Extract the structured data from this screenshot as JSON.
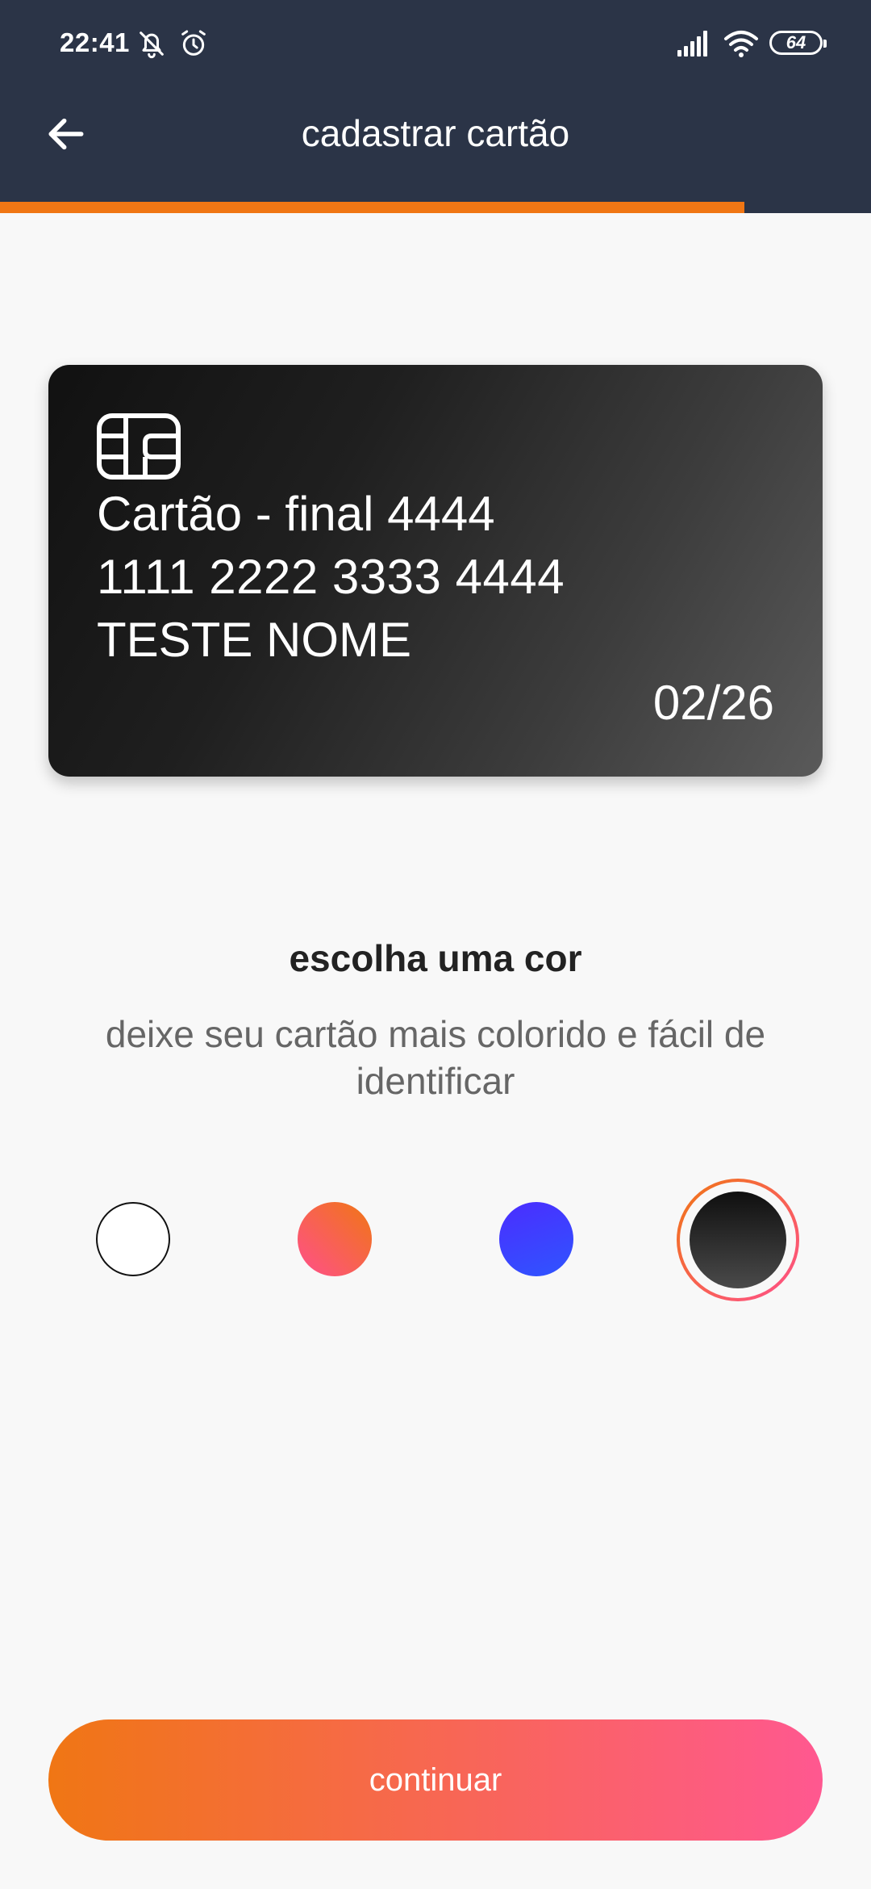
{
  "status_bar": {
    "time": "22:41",
    "battery_level": "64",
    "icons": [
      "bell-off-icon",
      "alarm-icon",
      "signal-icon",
      "wifi-icon",
      "battery-icon"
    ]
  },
  "header": {
    "title": "cadastrar cartão",
    "back_icon": "arrow-left-icon",
    "progress_fraction": 0.855,
    "background_color": "#2b3447",
    "progress_color": "#f07614"
  },
  "card": {
    "name": "Cartão - final 4444",
    "number": "1111 2222 3333 4444",
    "holder": "TESTE NOME",
    "expiry": "02/26",
    "chip_icon": "card-chip-icon",
    "selected_color": "black"
  },
  "color_picker": {
    "title": "escolha uma cor",
    "subtitle": "deixe seu cartão mais colorido e fácil de identificar",
    "options": [
      {
        "id": "white",
        "colors": [
          "#ffffff"
        ],
        "selected": false
      },
      {
        "id": "orange-pink",
        "colors": [
          "#f07614",
          "#ff4f8b"
        ],
        "selected": false
      },
      {
        "id": "blue",
        "colors": [
          "#4b2dff",
          "#2f55ff"
        ],
        "selected": false
      },
      {
        "id": "black",
        "colors": [
          "#0f0f0f",
          "#4a4a4a"
        ],
        "selected": true
      }
    ]
  },
  "actions": {
    "continue_label": "continuar",
    "button_gradient": [
      "#f07614",
      "#ff5890"
    ]
  }
}
